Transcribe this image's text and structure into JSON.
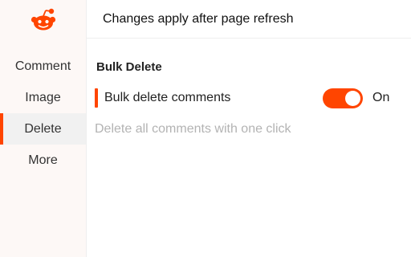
{
  "header": {
    "notice": "Changes apply after page refresh"
  },
  "sidebar": {
    "logo_icon": "reddit-alien-icon",
    "items": [
      {
        "label": "Comment",
        "active": false
      },
      {
        "label": "Image",
        "active": false
      },
      {
        "label": "Delete",
        "active": true
      },
      {
        "label": "More",
        "active": false
      }
    ]
  },
  "main": {
    "section_title": "Bulk Delete",
    "setting": {
      "label": "Bulk delete comments",
      "enabled": true,
      "state_label": "On",
      "description": "Delete all comments with one click"
    }
  },
  "colors": {
    "accent": "#ff4500",
    "sidebar_bg": "#fdf8f6",
    "active_item_bg": "#f1f1f1",
    "muted_text": "#b3b3b3"
  }
}
